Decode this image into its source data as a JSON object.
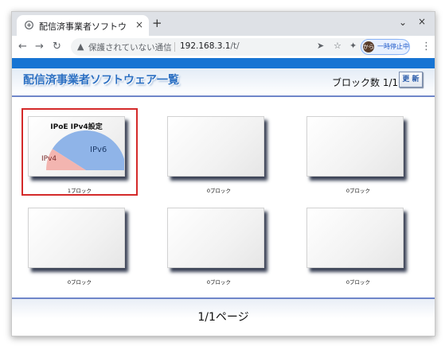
{
  "browser": {
    "tab_title": "配信済事業者ソフトウェ",
    "new_tab": "+",
    "tab_close": "×",
    "chevron": "⌄",
    "window_close": "×",
    "security_label": "保護されていない通信",
    "url_host": "192.168.3.1",
    "url_path": "/t/",
    "profile_avatar": "から",
    "profile_status": "一時停止中"
  },
  "page": {
    "title": "配信済事業者ソフトウェア一覧",
    "block_count": "ブロック数 1/10",
    "refresh_label": "更 新",
    "pager": "1/1ページ"
  },
  "tiles": [
    {
      "title": "IPoE IPv4設定",
      "label": "1ブロック",
      "ipv6": "IPv6",
      "ipv4": "IPv4",
      "ipv6_share": 0.82
    },
    {
      "label": "0ブロック"
    },
    {
      "label": "0ブロック"
    },
    {
      "label": "0ブロック"
    },
    {
      "label": "0ブロック"
    },
    {
      "label": "0ブロック"
    }
  ],
  "colors": {
    "topbar": "#1774d3",
    "title_text": "#2b6fc2",
    "ipv6_fill": "#8fb4e8",
    "ipv4_fill": "#f3b5b0",
    "selection": "#d42a2a"
  }
}
